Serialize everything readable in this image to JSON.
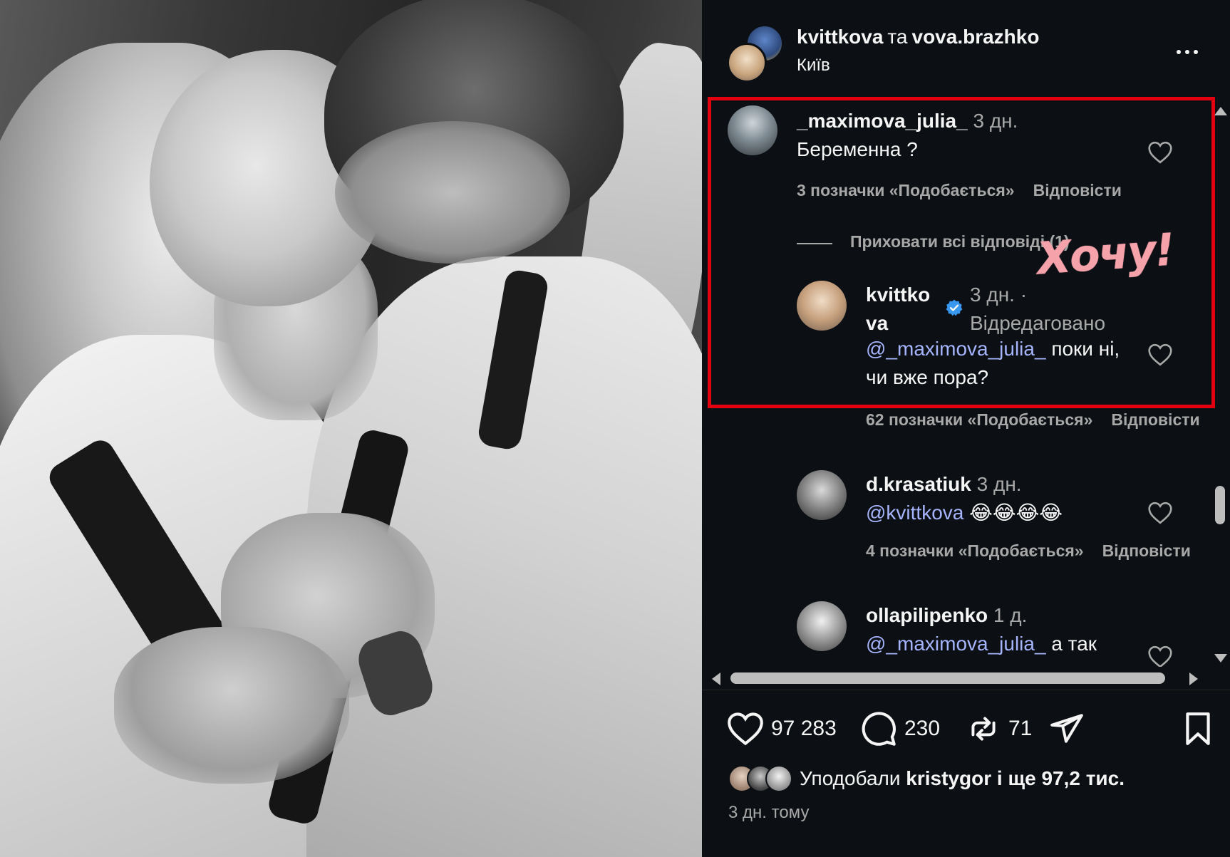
{
  "header": {
    "user1": "kvittkova",
    "joiner": "та",
    "user2": "vova.brazhko",
    "location": "Київ"
  },
  "comments": [
    {
      "username": "_maximova_julia_",
      "time": "3 дн.",
      "text": "Беременна ?",
      "likes": "3 позначки «Подобається»",
      "reply": "Відповісти"
    },
    {
      "hide_replies": "Приховати всі відповіді (1)"
    },
    {
      "username_line1": "kvittko",
      "username_line2": "va",
      "time_line1": "3 дн. ·",
      "time_line2": "Відредаговано",
      "mention": "@_maximova_julia_",
      "text_line1": " поки ні,",
      "text_line2": "чи вже пора?",
      "likes": "62 позначки «Подобається»",
      "reply": "Відповісти"
    },
    {
      "username": "d.krasatiuk",
      "time": "3 дн.",
      "mention": "@kvittkova",
      "emojis": "😂😂😂😂",
      "likes": "4 позначки «Подобається»",
      "reply": "Відповісти"
    },
    {
      "username": "ollapilipenko",
      "time": "1 д.",
      "mention": "@_maximova_julia_",
      "text": " а так"
    }
  ],
  "sticker": "Хочу!",
  "actions": {
    "likes": "97 283",
    "comments": "230",
    "reposts": "71"
  },
  "liked_by": {
    "prefix": "Уподобали",
    "user": "kristygor",
    "suffix": "і ще 97,2 тис."
  },
  "time_ago": "3 дн. тому",
  "colors": {
    "background": "#0c1014",
    "highlight": "#e3000f",
    "mention": "#a5b4fc",
    "muted": "#a8a8a8",
    "sticker": "#f6a2ab",
    "verified": "#3897f0"
  },
  "icons": [
    "more-icon",
    "heart-icon",
    "comment-icon",
    "repost-icon",
    "share-icon",
    "bookmark-icon",
    "verified-icon"
  ]
}
